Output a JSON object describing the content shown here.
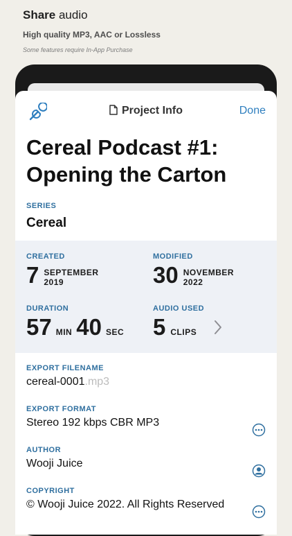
{
  "promo": {
    "title_bold": "Share",
    "title_rest": " audio",
    "subtitle": "High quality MP3, AAC or Lossless",
    "note": "Some features require In-App Purchase"
  },
  "nav": {
    "title": "Project Info",
    "done_label": "Done",
    "left_icon": "wrench-icon"
  },
  "project": {
    "title": "Cereal Podcast #1: Opening the Carton",
    "series_label": "SERIES",
    "series": "Cereal"
  },
  "stats": {
    "created": {
      "label": "CREATED",
      "day": "7",
      "month": "SEPTEMBER",
      "year": "2019"
    },
    "modified": {
      "label": "MODIFIED",
      "day": "30",
      "month": "NOVEMBER",
      "year": "2022"
    },
    "duration": {
      "label": "DURATION",
      "minutes": "57",
      "min_unit": "MIN",
      "seconds": "40",
      "sec_unit": "SEC"
    },
    "audio_used": {
      "label": "AUDIO USED",
      "count": "5",
      "unit": "CLIPS"
    }
  },
  "fields": {
    "filename": {
      "label": "EXPORT FILENAME",
      "value": "cereal-0001",
      "ext": ".mp3"
    },
    "format": {
      "label": "EXPORT FORMAT",
      "value": "Stereo 192 kbps CBR MP3"
    },
    "author": {
      "label": "AUTHOR",
      "value": "Wooji Juice"
    },
    "copyright": {
      "label": "COPYRIGHT",
      "value": "© Wooji Juice 2022. All Rights Reserved"
    }
  },
  "colors": {
    "accent": "#2f7fbf",
    "label": "#2f6f9f",
    "stats_bg": "#eef1f6"
  }
}
